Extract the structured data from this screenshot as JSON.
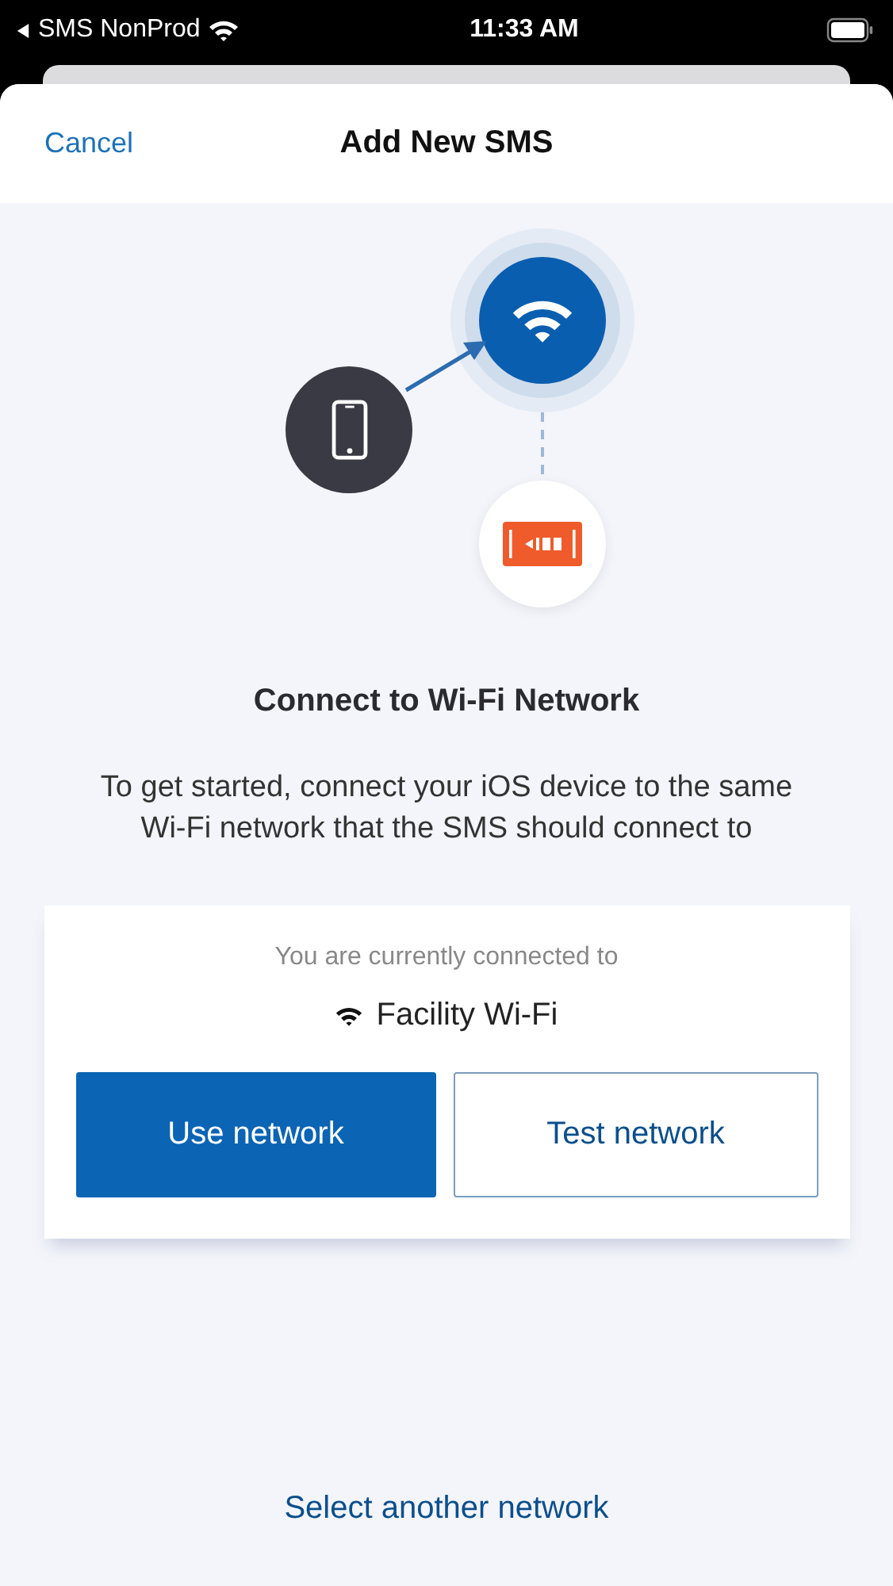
{
  "status_bar": {
    "back_label": "SMS NonProd",
    "time": "11:33 AM"
  },
  "header": {
    "cancel": "Cancel",
    "title": "Add New SMS"
  },
  "heading": "Connect to Wi-Fi Network",
  "description": "To get started, connect your iOS device to the same Wi-Fi network that the SMS should connect to",
  "card": {
    "caption": "You are currently connected to",
    "network": "Facility Wi-Fi",
    "buttons": [
      {
        "label": "Use network",
        "kind": "primary"
      },
      {
        "label": "Test network",
        "kind": "secondary"
      }
    ]
  },
  "link": "Select another network"
}
